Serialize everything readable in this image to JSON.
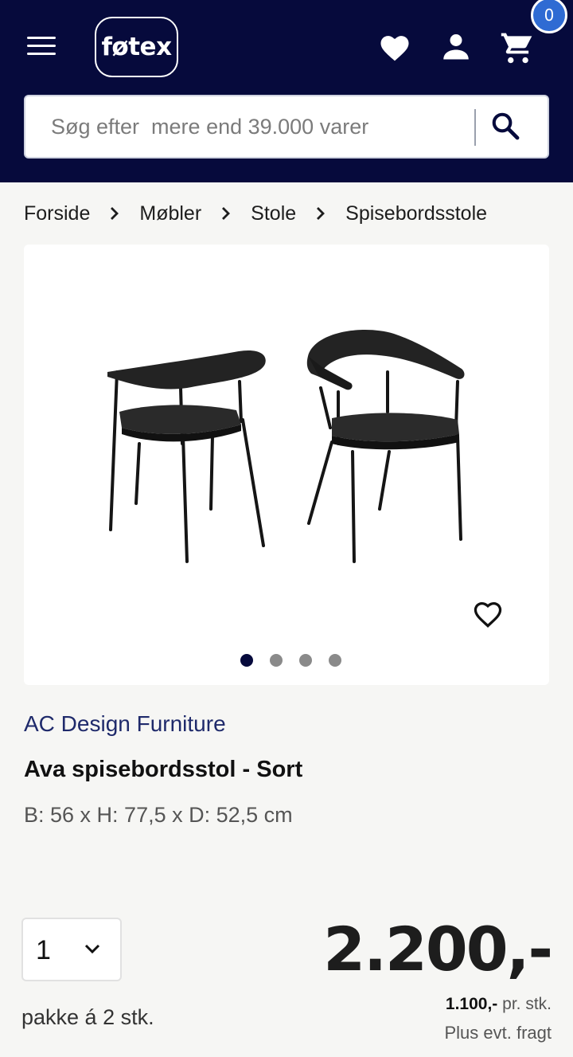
{
  "header": {
    "logo_text": "føtex",
    "cart_count": "0",
    "brand_color": "#060a3c",
    "badge_color": "#2f6bd3"
  },
  "search": {
    "placeholder": "Søg efter  mere end 39.000 varer"
  },
  "breadcrumb": [
    "Forside",
    "Møbler",
    "Stole",
    "Spisebordsstole"
  ],
  "product": {
    "brand": "AC Design Furniture",
    "title": "Ava spisebordsstol - Sort",
    "dimensions": "B: 56 x H: 77,5 x D: 52,5 cm",
    "image_count": 4,
    "active_image": 1
  },
  "purchase": {
    "quantity": "1",
    "pack_info": "pakke á 2 stk.",
    "price": "2.200,-",
    "unit_price_value": "1.100,-",
    "unit_price_suffix": " pr. stk.",
    "freight_note": "Plus evt. fragt"
  },
  "icons": [
    "menu-icon",
    "heart-icon",
    "user-icon",
    "cart-icon",
    "search-icon",
    "chevron-right-icon",
    "chevron-down-icon"
  ]
}
